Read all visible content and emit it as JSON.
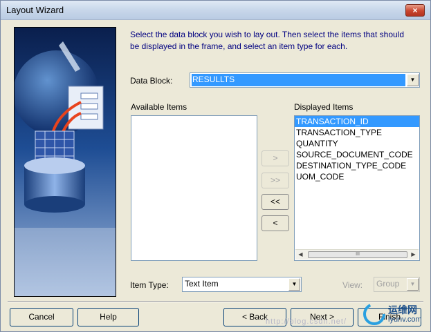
{
  "window": {
    "title": "Layout Wizard",
    "close_label": "×"
  },
  "instructions": "Select the data block you wish to lay out. Then select the items that should be displayed in the frame, and select an item type for each.",
  "data_block": {
    "label": "Data Block:",
    "value": "RESULLTS"
  },
  "available": {
    "label": "Available Items",
    "items": []
  },
  "displayed": {
    "label": "Displayed Items",
    "items": [
      "TRANSACTION_ID",
      "TRANSACTION_TYPE",
      "QUANTITY",
      "SOURCE_DOCUMENT_CODE",
      "DESTINATION_TYPE_CODE",
      "UOM_CODE"
    ],
    "selected_index": 0
  },
  "move_buttons": {
    "add": ">",
    "add_all": ">>",
    "remove_all": "<<",
    "remove": "<"
  },
  "item_type": {
    "label": "Item Type:",
    "value": "Text Item"
  },
  "view": {
    "label": "View:",
    "value": "Group"
  },
  "footer": {
    "cancel": "Cancel",
    "help": "Help",
    "back": "< Back",
    "next": "Next >",
    "finish": "Finish"
  },
  "watermark": "http://blog.csdn.net/",
  "logo_text": {
    "main": "运维网",
    "sub": "iyunv.com"
  }
}
